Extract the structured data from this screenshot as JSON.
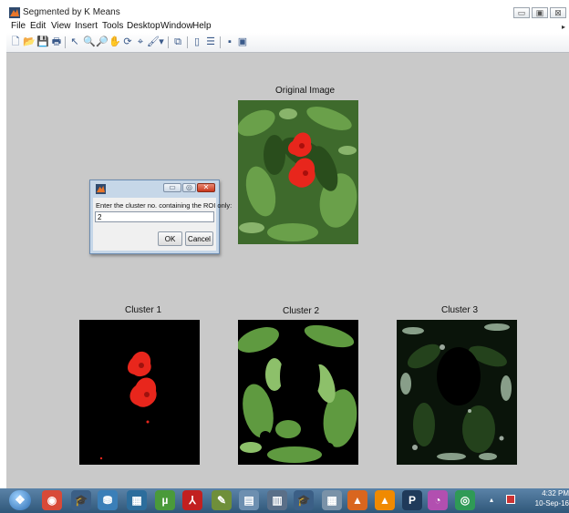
{
  "window": {
    "title": "Segmented by K Means",
    "controls": {
      "minimize": "▭",
      "maximize": "▣",
      "close": "⊠"
    }
  },
  "menu": [
    "File",
    "Edit",
    "View",
    "Insert",
    "Tools",
    "Desktop",
    "Window",
    "Help"
  ],
  "menu_overflow": "▸",
  "toolbar": {
    "buttons": [
      {
        "name": "new-figure-icon",
        "glyph": "🗋"
      },
      {
        "name": "open-file-icon",
        "glyph": "📂"
      },
      {
        "name": "save-icon",
        "glyph": "💾"
      },
      {
        "name": "print-icon",
        "glyph": "🖶"
      },
      {
        "name": "edit-plot-arrow-icon",
        "glyph": "↖"
      },
      {
        "name": "zoom-in-icon",
        "glyph": "🔍"
      },
      {
        "name": "zoom-out-icon",
        "glyph": "🔎"
      },
      {
        "name": "pan-hand-icon",
        "glyph": "✋"
      },
      {
        "name": "rotate-3d-icon",
        "glyph": "⟳"
      },
      {
        "name": "data-cursor-icon",
        "glyph": "⌖"
      },
      {
        "name": "brush-icon",
        "glyph": "🖌"
      },
      {
        "name": "brush-dropdown-icon",
        "glyph": "▾"
      },
      {
        "name": "link-plot-icon",
        "glyph": "⧉"
      },
      {
        "name": "colorbar-icon",
        "glyph": "▯"
      },
      {
        "name": "legend-icon",
        "glyph": "☰"
      },
      {
        "name": "hide-plot-tools-icon",
        "glyph": "▪"
      },
      {
        "name": "show-plot-tools-icon",
        "glyph": "▣"
      }
    ]
  },
  "figure": {
    "original_title": "Original Image",
    "cluster_titles": [
      "Cluster 1",
      "Cluster 2",
      "Cluster 3"
    ]
  },
  "dialog": {
    "prompt": "Enter the cluster no. containing the ROI only:",
    "input_value": "2",
    "ok_label": "OK",
    "cancel_label": "Cancel",
    "controls": {
      "minimize": "▭",
      "maximize": "◎",
      "close": "✕"
    }
  },
  "taskbar": {
    "start_glyph": "❖",
    "apps": [
      {
        "name": "chrome-icon",
        "glyph": "◉",
        "color": "#d84a38"
      },
      {
        "name": "graduation-app-icon",
        "glyph": "🎓",
        "color": "#3b5f86"
      },
      {
        "name": "network-app-icon",
        "glyph": "⛃",
        "color": "#3b7fb8"
      },
      {
        "name": "photo-app-icon",
        "glyph": "▦",
        "color": "#2c6d9c"
      },
      {
        "name": "utorrent-icon",
        "glyph": "µ",
        "color": "#4a9a3a"
      },
      {
        "name": "pdf-reader-icon",
        "glyph": "⅄",
        "color": "#c22020"
      },
      {
        "name": "paint-tools-icon",
        "glyph": "✎",
        "color": "#6f8f3a"
      },
      {
        "name": "notepad-icon",
        "glyph": "▤",
        "color": "#6d8fb0"
      },
      {
        "name": "document-viewer-icon",
        "glyph": "▥",
        "color": "#5a6f88"
      },
      {
        "name": "graduation-app-2-icon",
        "glyph": "🎓",
        "color": "#3b5f86"
      },
      {
        "name": "calculator-icon",
        "glyph": "▦",
        "color": "#7a92a8"
      },
      {
        "name": "matlab-icon",
        "glyph": "▲",
        "color": "#d9661f"
      },
      {
        "name": "vlc-icon",
        "glyph": "▲",
        "color": "#f08a00"
      },
      {
        "name": "p-app-icon",
        "glyph": "P",
        "color": "#1f3a5a"
      },
      {
        "name": "picasa-icon",
        "glyph": "◔",
        "color": "#b24fb0"
      },
      {
        "name": "tripadvisor-icon",
        "glyph": "◎",
        "color": "#2f9a56"
      }
    ],
    "clock_time": "4:32 PM",
    "clock_date": "10-Sep-16"
  },
  "colors": {
    "figure_bg": "#c9c9c9",
    "flower_red": "#e8261c",
    "taskbar": "#3f6a92",
    "dialog_close": "#d9472c"
  }
}
